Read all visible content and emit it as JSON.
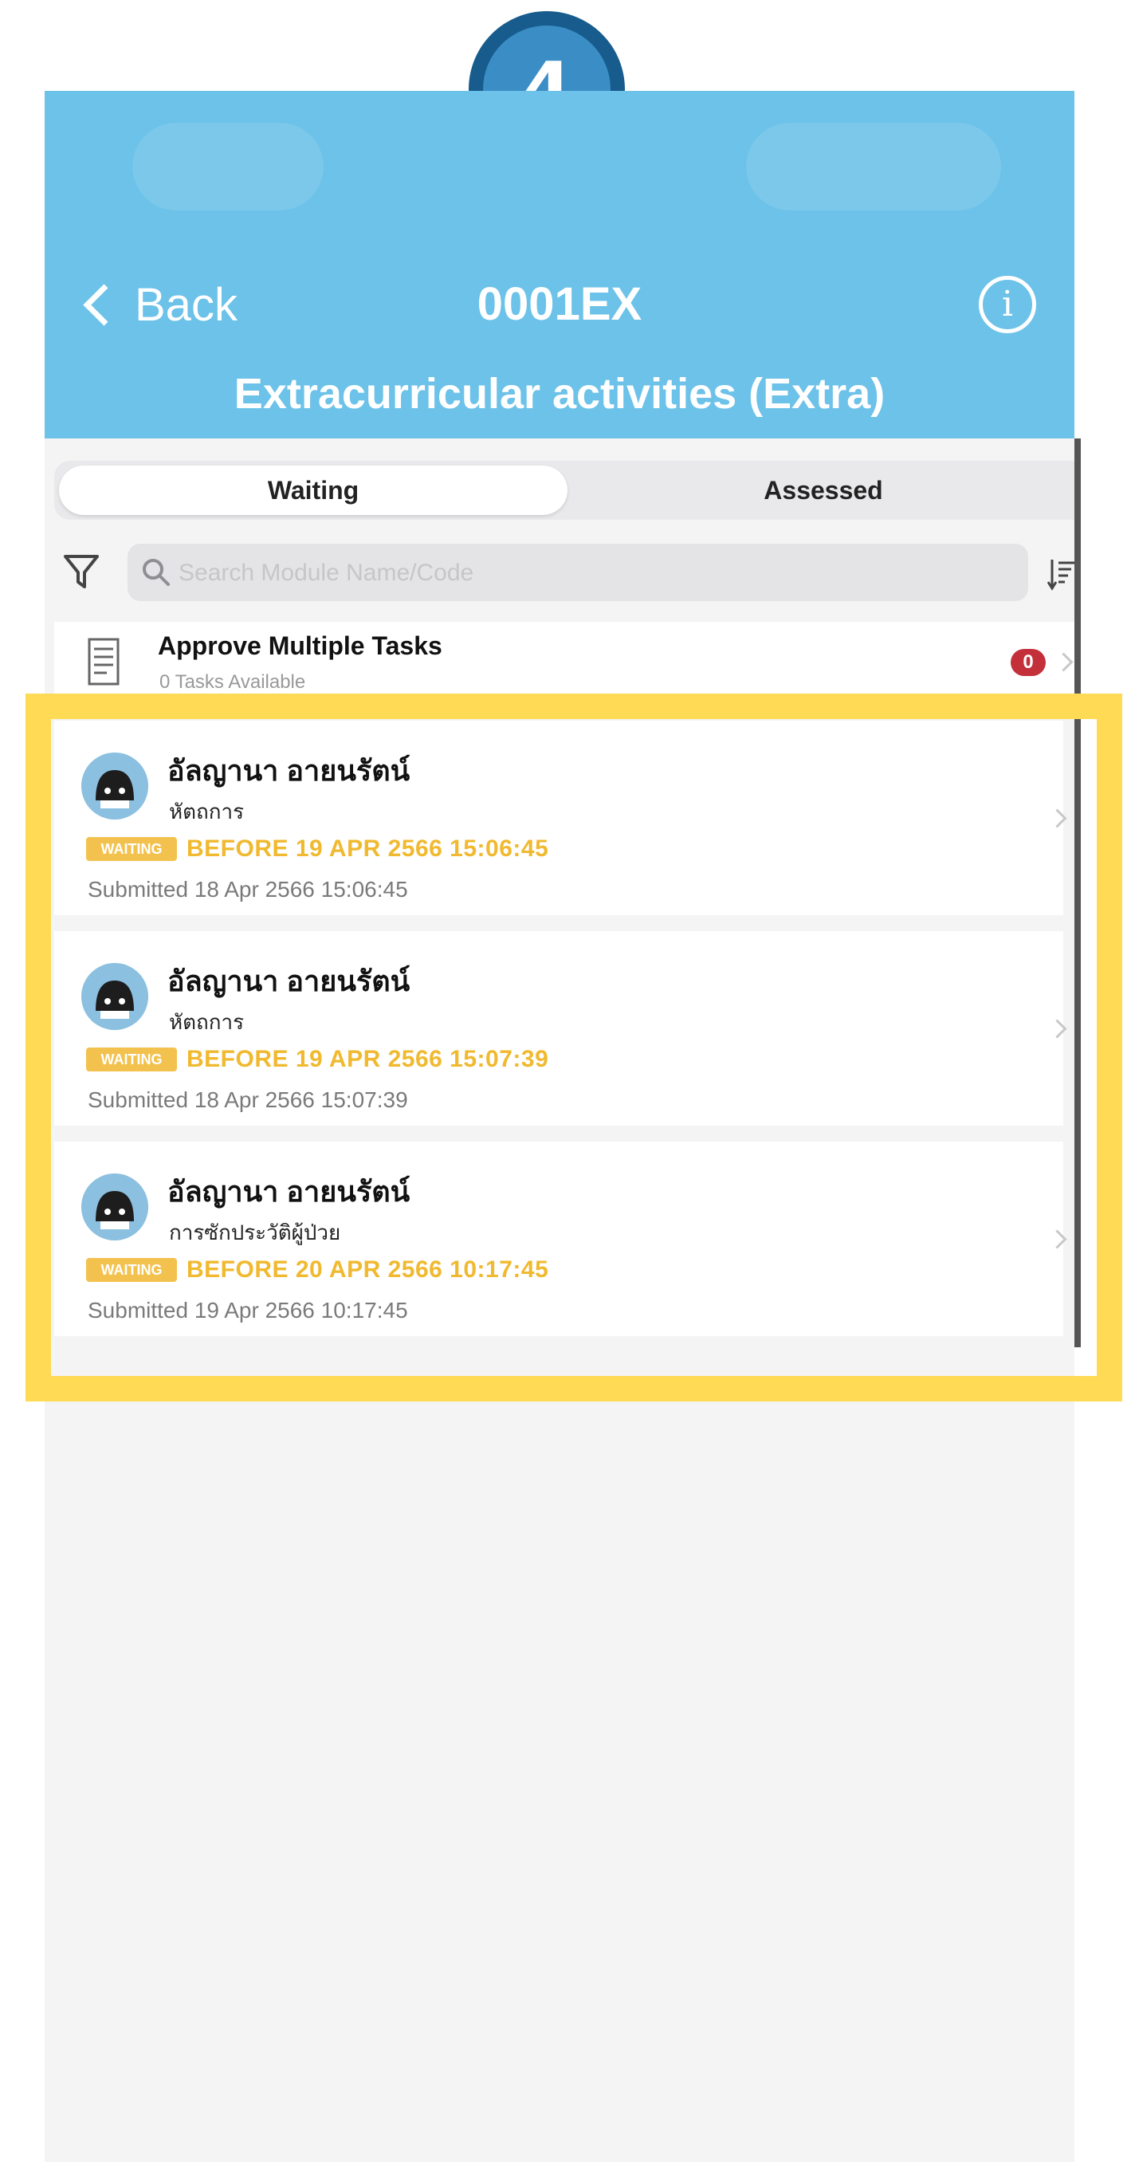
{
  "step": {
    "number": "4"
  },
  "header": {
    "back_label": "Back",
    "code": "0001EX",
    "subtitle": "Extracurricular activities (Extra)",
    "info_glyph": "i"
  },
  "tabs": [
    {
      "label": "Waiting",
      "selected": true
    },
    {
      "label": "Assessed",
      "selected": false
    }
  ],
  "search": {
    "placeholder": "Search Module Name/Code",
    "value": ""
  },
  "approve": {
    "title": "Approve Multiple Tasks",
    "subtitle": "0 Tasks Available",
    "count": "0"
  },
  "tasks": [
    {
      "name": "อัลญานา อายนรัตน์",
      "activity": "หัตถการ",
      "status": "WAITING",
      "deadline": "BEFORE 19 APR 2566 15:06:45",
      "submitted": "Submitted 18 Apr 2566 15:06:45"
    },
    {
      "name": "อัลญานา อายนรัตน์",
      "activity": "หัตถการ",
      "status": "WAITING",
      "deadline": "BEFORE 19 APR 2566 15:07:39",
      "submitted": "Submitted 18 Apr 2566 15:07:39"
    },
    {
      "name": "อัลญานา อายนรัตน์",
      "activity": "การซักประวัติผู้ป่วย",
      "status": "WAITING",
      "deadline": "BEFORE 20 APR 2566 10:17:45",
      "submitted": "Submitted 19 Apr 2566 10:17:45"
    }
  ],
  "icons": {
    "back": "chevron-left-icon",
    "info": "info-circle-icon",
    "filter": "filter-icon",
    "search": "search-icon",
    "sort": "sort-icon",
    "document": "document-icon",
    "row_chevron": "chevron-right-icon",
    "avatar": "avatar-icon"
  },
  "colors": {
    "header_bg": "#6cc2e8",
    "step_badge": "#175c8c",
    "highlight": "#ffda55",
    "waiting": "#f3c24e",
    "count_badge": "#c3303a"
  }
}
